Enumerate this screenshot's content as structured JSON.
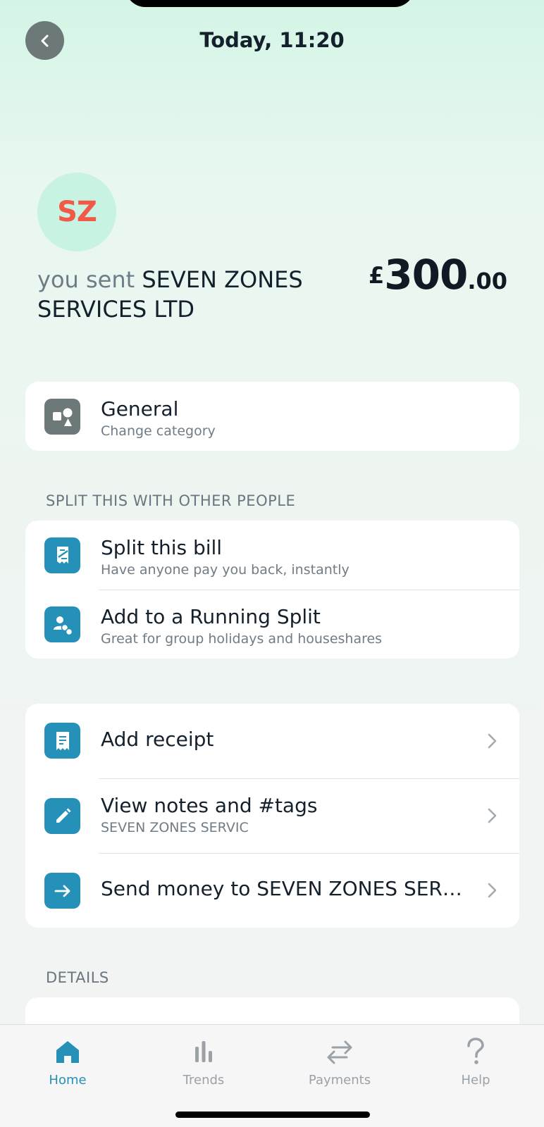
{
  "header": {
    "title": "Today, 11:20"
  },
  "transaction": {
    "avatar_initials": "SZ",
    "sent_prefix": "you sent",
    "merchant": "SEVEN ZONES SERVICES LTD",
    "amount_currency": "£",
    "amount_major": "300",
    "amount_minor": ".00"
  },
  "category": {
    "title": "General",
    "subtitle": "Change category",
    "icon": "shapes-icon"
  },
  "split_section": {
    "label": "SPLIT THIS WITH OTHER PEOPLE",
    "items": [
      {
        "title": "Split this bill",
        "subtitle": "Have anyone pay you back, instantly",
        "icon": "split-bill-icon"
      },
      {
        "title": "Add to a Running Split",
        "subtitle": "Great for group holidays and houseshares",
        "icon": "running-split-icon"
      }
    ]
  },
  "actions": {
    "items": [
      {
        "title": "Add receipt",
        "icon": "receipt-icon"
      },
      {
        "title": "View notes and #tags",
        "subtitle": "SEVEN ZONES SERVIC",
        "icon": "pencil-icon"
      },
      {
        "title": "Send money to SEVEN ZONES SER…",
        "icon": "arrow-right-icon"
      }
    ]
  },
  "details_section": {
    "label": "DETAILS"
  },
  "tabbar": {
    "tabs": [
      {
        "label": "Home",
        "icon": "home-icon",
        "active": true
      },
      {
        "label": "Trends",
        "icon": "bar-chart-icon",
        "active": false
      },
      {
        "label": "Payments",
        "icon": "transfer-icon",
        "active": false
      },
      {
        "label": "Help",
        "icon": "question-icon",
        "active": false
      }
    ]
  },
  "colors": {
    "accent": "#2590b8",
    "avatar_text": "#f05a47",
    "avatar_bg": "#c8f2e2"
  }
}
